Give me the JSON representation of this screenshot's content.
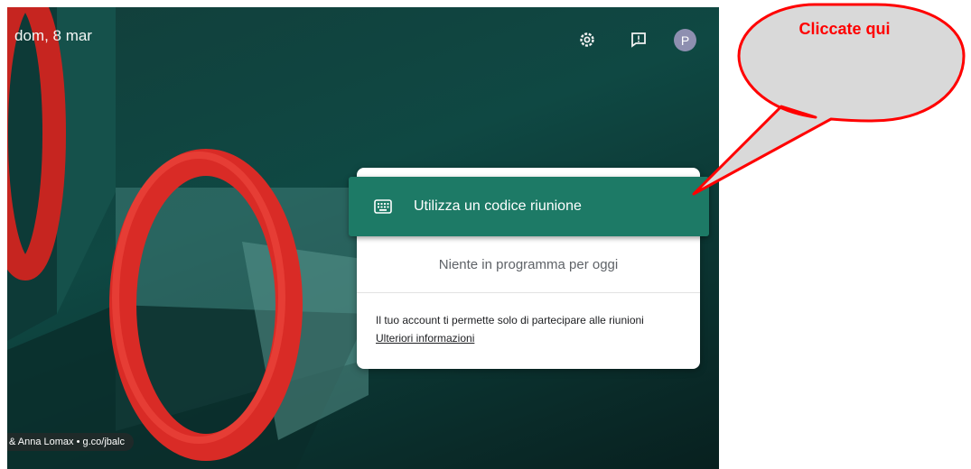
{
  "header": {
    "date": "dom, 8 mar",
    "avatar_initial": "P"
  },
  "icons": {
    "settings": "gear-icon",
    "feedback": "feedback-icon",
    "keyboard": "keyboard-icon"
  },
  "card": {
    "code_button_label": "Utilizza un codice riunione",
    "empty_message": "Niente in programma per oggi",
    "info_text": "Il tuo account ti permette solo di partecipare alle riunioni",
    "info_link": "Ulteriori informazioni"
  },
  "background": {
    "credit": "& Anna Lomax • g.co/jbalc"
  },
  "annotation": {
    "text": "Cliccate qui",
    "color": "#ff0000"
  },
  "colors": {
    "accent": "#1d7a66",
    "ring": "#d92b26"
  }
}
